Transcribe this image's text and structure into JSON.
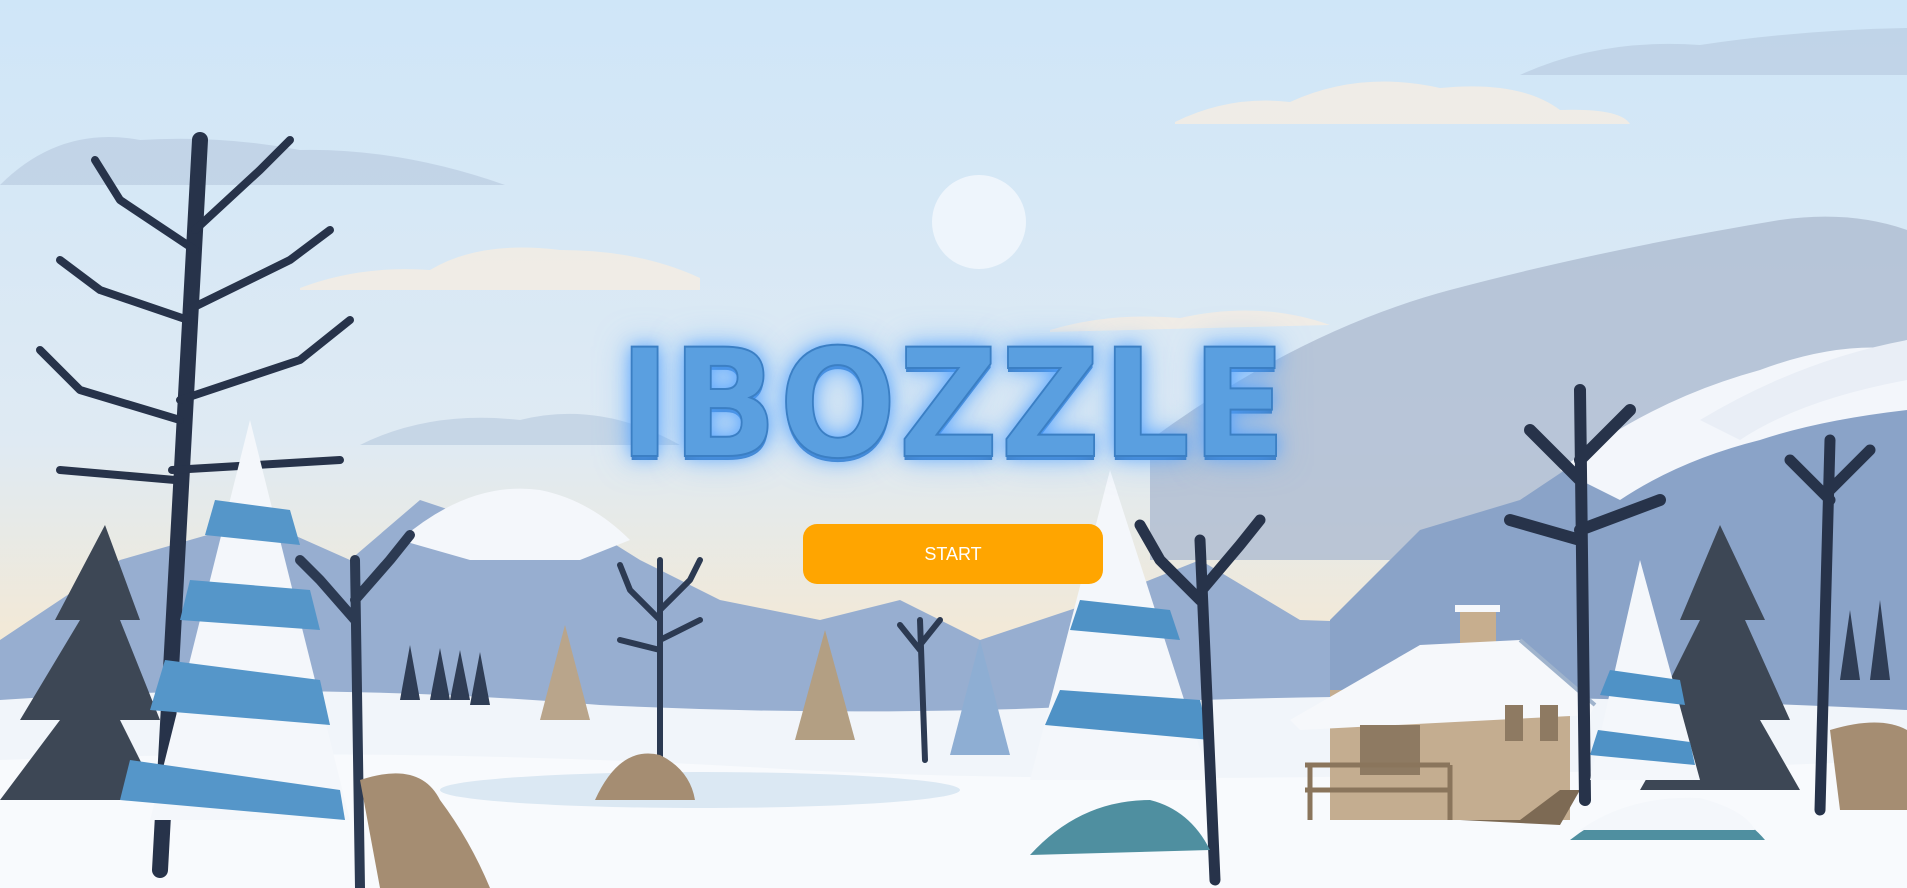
{
  "game": {
    "title": "IBOZZLE",
    "start_label": "START"
  },
  "colors": {
    "sky": "#d3e8f8",
    "title": "#5a9fe0",
    "button": "#ffa500",
    "button_text": "#ffffff"
  }
}
